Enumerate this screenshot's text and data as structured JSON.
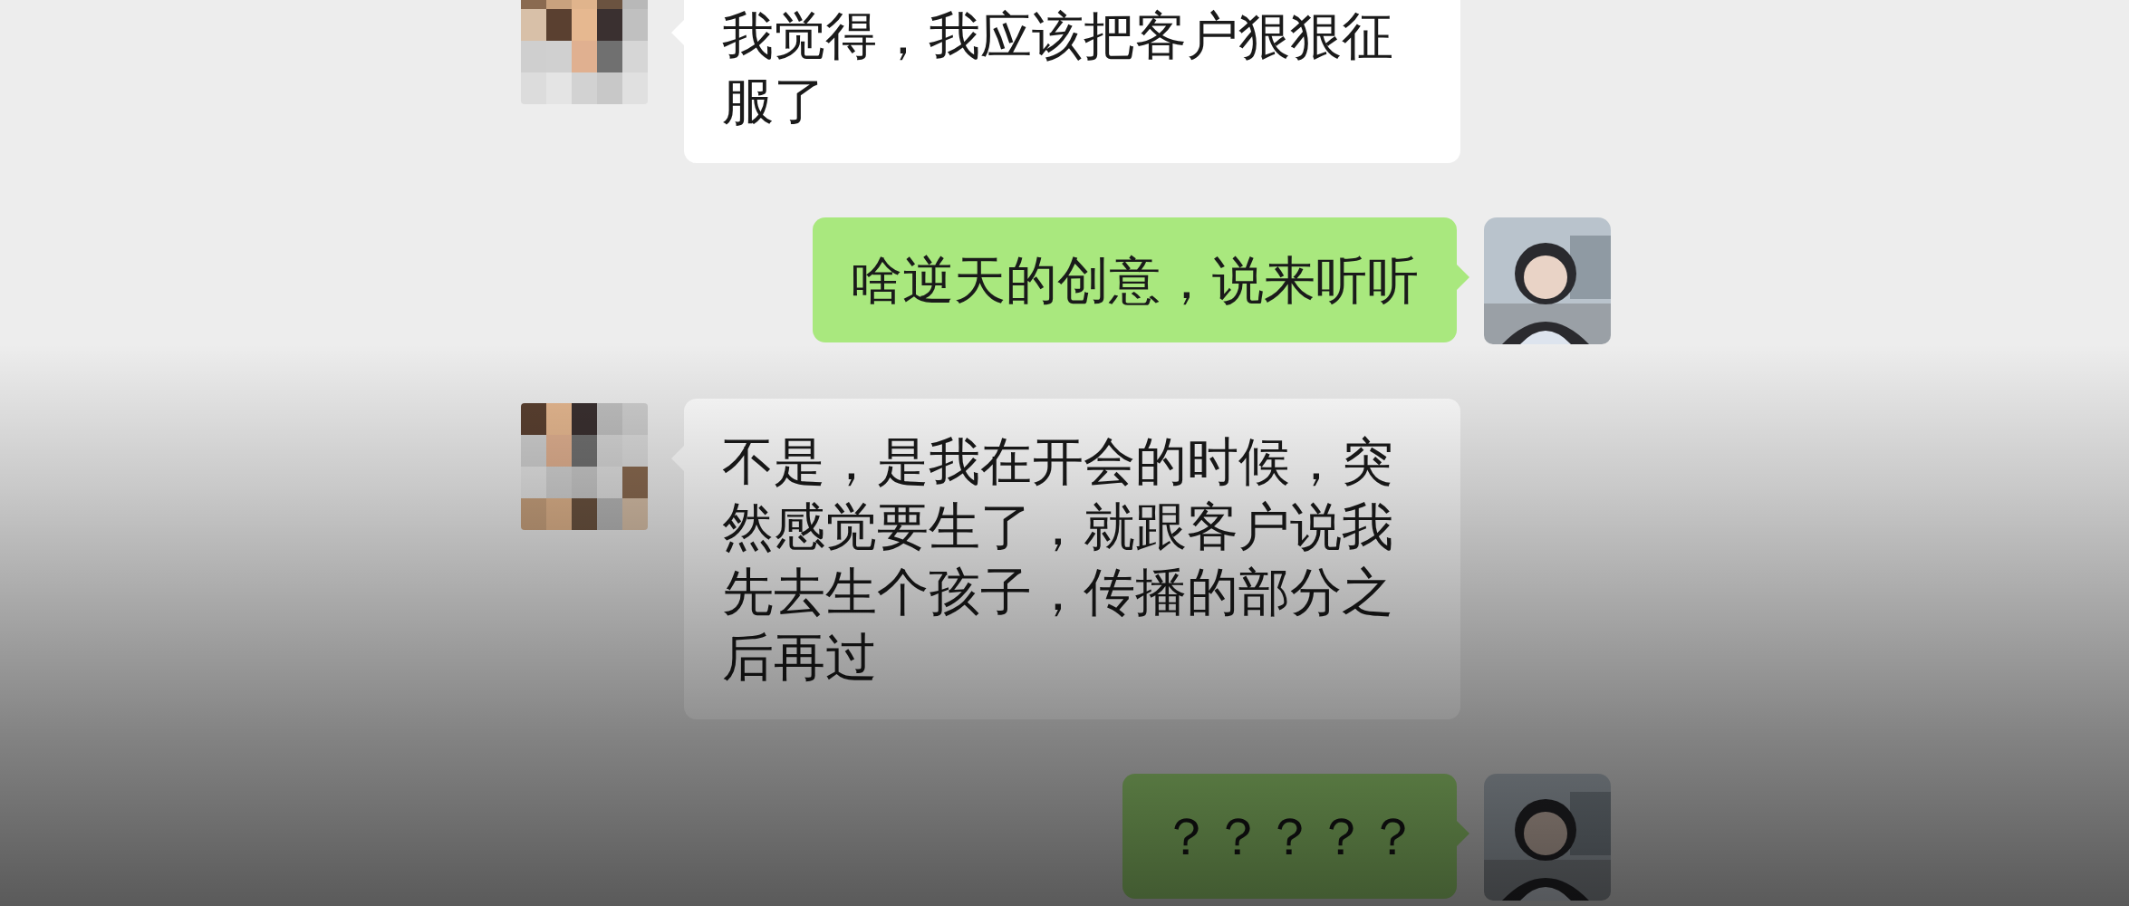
{
  "messages": [
    {
      "kind": "incoming",
      "text": "我觉得，我应该把客户狠狠征服了"
    },
    {
      "kind": "outgoing",
      "text": "啥逆天的创意，说来听听"
    },
    {
      "kind": "incoming",
      "text": "不是，是我在开会的时候，突然感觉要生了，就跟客户说我先去生个孩子，传播的部分之后再过"
    },
    {
      "kind": "outgoing",
      "text": "？？？？？"
    }
  ]
}
